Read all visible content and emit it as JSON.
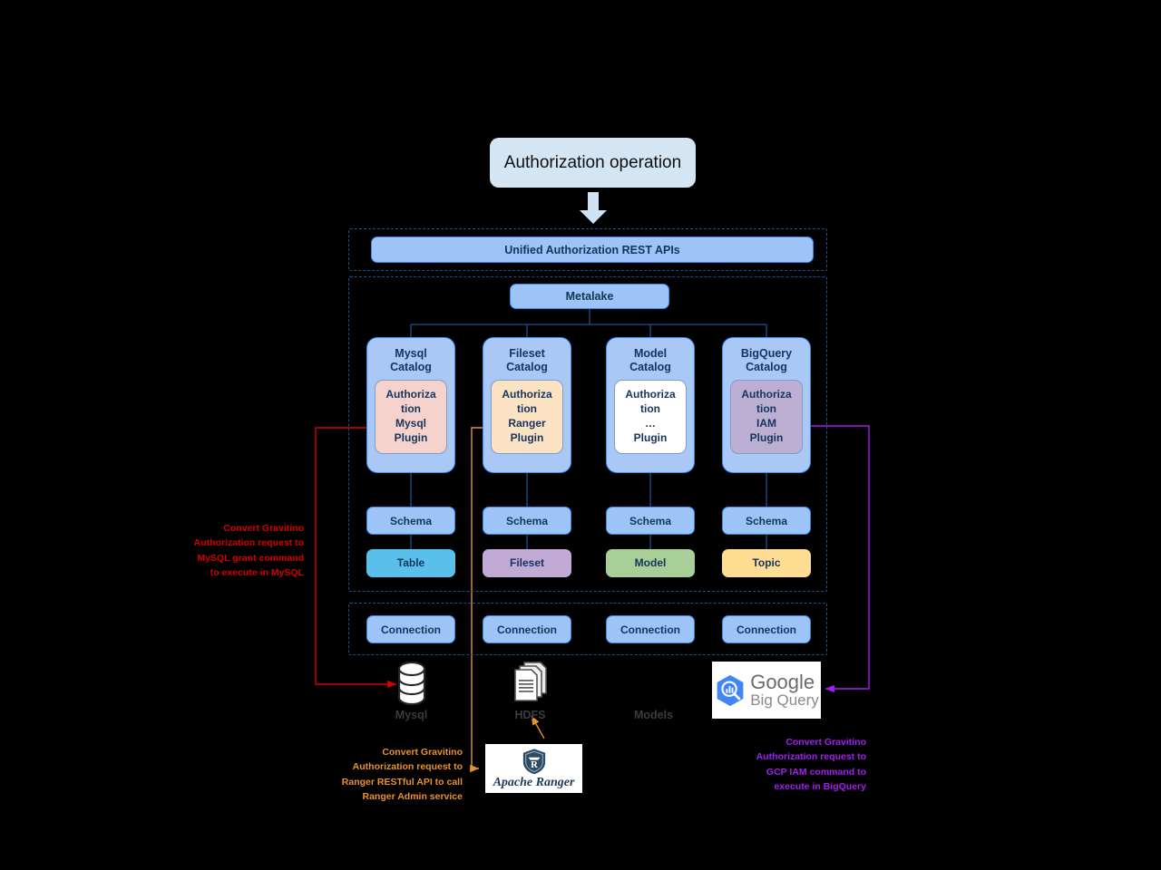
{
  "diagram": {
    "title_node": {
      "label": "Authorization operation"
    },
    "rest_api_bar": {
      "label": "Unified Authorization REST APIs"
    },
    "metalake": {
      "label": "Metalake"
    },
    "catalogs": [
      {
        "name": "Mysql\nCatalog",
        "plugin": "Authoriza\ntion\nMysql\nPlugin",
        "plugin_color": "#f6d2cd",
        "schema": "Schema",
        "entity": "Table",
        "entity_color": "#59c0ec",
        "connection": "Connection"
      },
      {
        "name": "Fileset\nCatalog",
        "plugin": "Authoriza\ntion\nRanger\nPlugin",
        "plugin_color": "#fce3c3",
        "schema": "Schema",
        "entity": "Fileset",
        "entity_color": "#c2aad6",
        "connection": "Connection"
      },
      {
        "name": "Model\nCatalog",
        "plugin": "Authoriza\ntion\n…\nPlugin",
        "plugin_color": "#ffffff",
        "schema": "Schema",
        "entity": "Model",
        "entity_color": "#a8cf98",
        "connection": "Connection"
      },
      {
        "name": "BigQuery\nCatalog",
        "plugin": "Authoriza\ntion\nIAM\nPlugin",
        "plugin_color": "#bdaed4",
        "schema": "Schema",
        "entity": "Topic",
        "entity_color": "#ffdd92",
        "connection": "Connection"
      }
    ],
    "sources": [
      {
        "label": "Mysql",
        "icon": "database-cylinder-icon"
      },
      {
        "label": "HDFS",
        "icon": "stacked-documents-icon"
      },
      {
        "label": "Models",
        "icon": "none"
      }
    ],
    "logos": {
      "bigquery": {
        "line1": "Google",
        "line2": "Big Query",
        "icon": "google-bigquery-hex-icon"
      },
      "ranger": {
        "label": "Apache Ranger",
        "icon": "apache-ranger-shield-icon"
      }
    },
    "annotations": [
      {
        "id": "mysql-note",
        "color": "#d40000",
        "text": "Convert Gravitino\nAuthorization request  to\nMySQL grant command\nto execute in MySQL"
      },
      {
        "id": "ranger-note",
        "color": "#e8922b",
        "text": "Convert Gravitino\nAuthorization request  to\nRanger RESTful API to call\nRanger Admin service"
      },
      {
        "id": "bigquery-note",
        "color": "#a41df0",
        "text": "Convert Gravitino\nAuthorization request  to\nGCP IAM command to\nexecute in BigQuery"
      }
    ],
    "colors": {
      "connector": "#1d4f8f",
      "dash_border": "#1d4f8f",
      "node_fill": "#9dc3f7",
      "node_stroke": "#2f8ef0",
      "catalog_fill": "#a9c8f5",
      "title_fill": "#d4e6f4",
      "arrow_red": "#d40000",
      "arrow_orange": "#e8922b",
      "arrow_purple": "#a41df0"
    }
  }
}
